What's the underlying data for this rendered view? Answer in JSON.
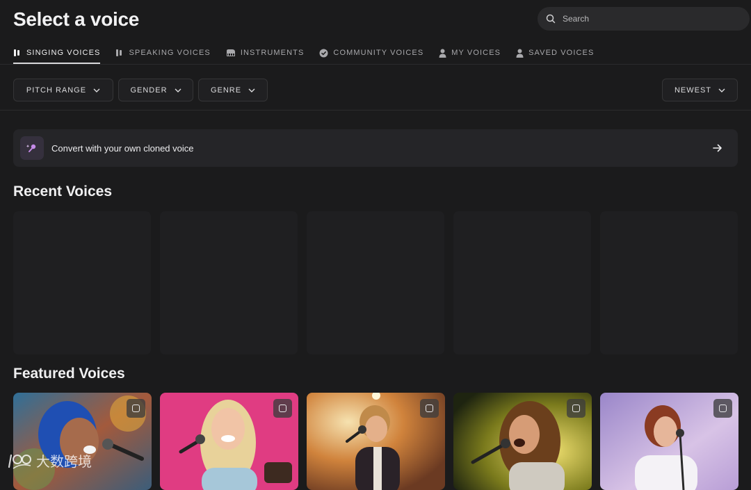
{
  "header": {
    "title": "Select a voice",
    "search_placeholder": "Search"
  },
  "tabs": [
    {
      "label": "SINGING VOICES",
      "icon": "voice-bars-icon",
      "active": true
    },
    {
      "label": "SPEAKING VOICES",
      "icon": "voice-bars-icon",
      "active": false
    },
    {
      "label": "INSTRUMENTS",
      "icon": "piano-icon",
      "active": false
    },
    {
      "label": "COMMUNITY VOICES",
      "icon": "verified-badge-icon",
      "active": false
    },
    {
      "label": "MY VOICES",
      "icon": "person-icon",
      "active": false
    },
    {
      "label": "SAVED VOICES",
      "icon": "person-icon",
      "active": false
    }
  ],
  "filters": {
    "pitch_range": "PITCH RANGE",
    "gender": "GENDER",
    "genre": "GENRE",
    "sort": "NEWEST"
  },
  "banner": {
    "text": "Convert with your own cloned voice",
    "icon": "sparkle-mic-icon"
  },
  "sections": {
    "recent": "Recent Voices",
    "featured": "Featured Voices"
  },
  "featured_cards": [
    {
      "icon": "bookmark-icon",
      "bg": "#3a5f8a"
    },
    {
      "icon": "bookmark-icon",
      "bg": "#e03c82"
    },
    {
      "icon": "bookmark-icon",
      "bg": "#c8793a"
    },
    {
      "icon": "bookmark-icon",
      "bg": "#6b6a18"
    },
    {
      "icon": "bookmark-icon",
      "bg": "#b7a6d8"
    }
  ],
  "watermark": {
    "text": "大数跨境",
    "logo": "100-logo-icon"
  },
  "colors": {
    "background": "#1b1b1c",
    "surface": "#252528",
    "accent": "#c58be8"
  }
}
